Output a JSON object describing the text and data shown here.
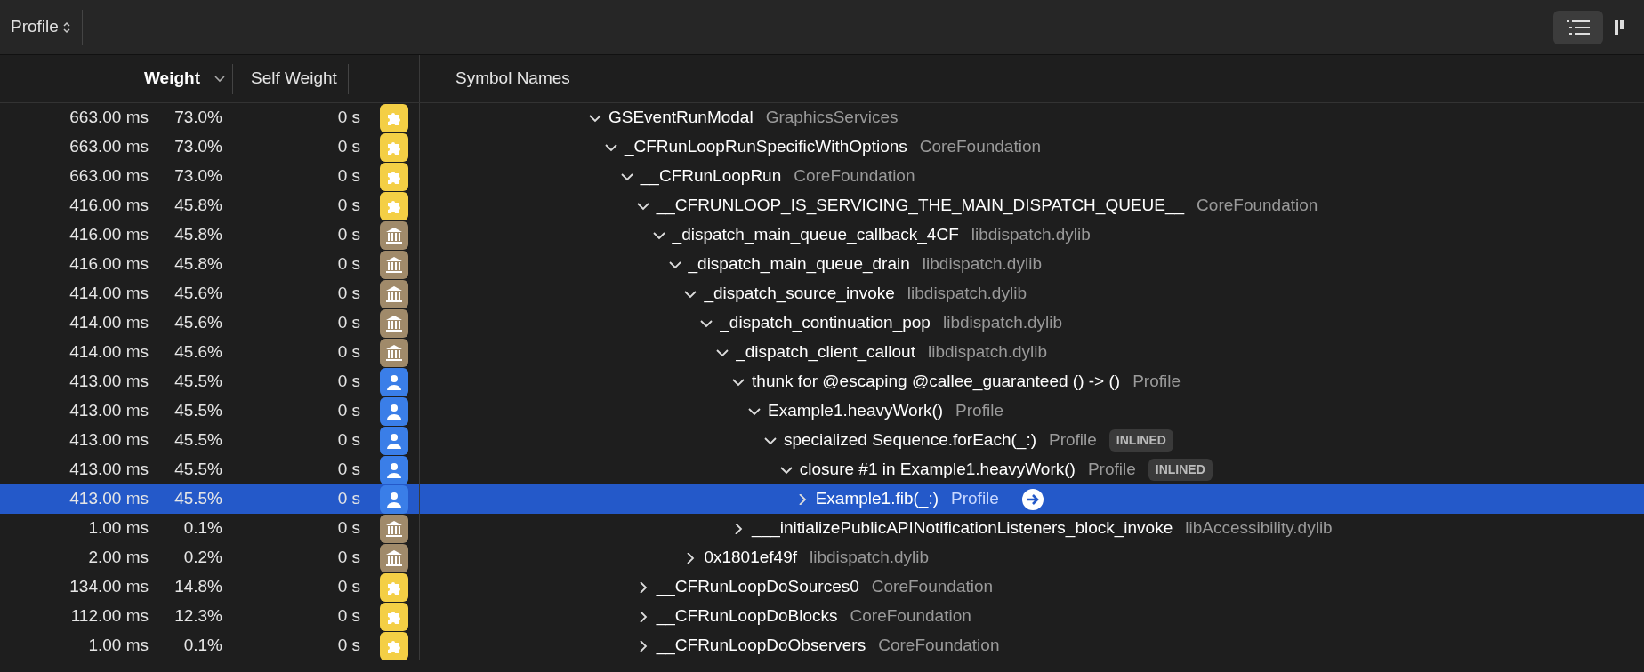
{
  "toolbar": {
    "view_menu": {
      "label": "Profile"
    },
    "view_buttons": [
      {
        "kind": "list",
        "selected": true
      },
      {
        "kind": "columns",
        "selected": false
      }
    ]
  },
  "columns": [
    {
      "label": "Weight",
      "sorted": true
    },
    {
      "label": "Self Weight",
      "sorted": false
    },
    {
      "label": "Symbol Names",
      "sorted": false
    }
  ],
  "call_tree": [
    {
      "name": "GSEventRunModal",
      "library": "GraphicsServices",
      "weight": "663.00 ms",
      "percent": "73.0%",
      "self_weight": "0 s",
      "kind": "plugin",
      "expanded": true,
      "selected": false,
      "children": [
        {
          "name": "_CFRunLoopRunSpecificWithOptions",
          "library": "CoreFoundation",
          "weight": "663.00 ms",
          "percent": "73.0%",
          "self_weight": "0 s",
          "kind": "plugin",
          "expanded": true,
          "selected": false,
          "children": [
            {
              "name": "__CFRunLoopRun",
              "library": "CoreFoundation",
              "weight": "663.00 ms",
              "percent": "73.0%",
              "self_weight": "0 s",
              "kind": "plugin",
              "expanded": true,
              "selected": false,
              "children": [
                {
                  "name": "__CFRUNLOOP_IS_SERVICING_THE_MAIN_DISPATCH_QUEUE__",
                  "library": "CoreFoundation",
                  "weight": "416.00 ms",
                  "percent": "45.8%",
                  "self_weight": "0 s",
                  "kind": "plugin",
                  "expanded": true,
                  "selected": false,
                  "children": [
                    {
                      "name": "_dispatch_main_queue_callback_4CF",
                      "library": "libdispatch.dylib",
                      "weight": "416.00 ms",
                      "percent": "45.8%",
                      "self_weight": "0 s",
                      "kind": "library",
                      "expanded": true,
                      "selected": false,
                      "children": [
                        {
                          "name": "_dispatch_main_queue_drain",
                          "library": "libdispatch.dylib",
                          "weight": "416.00 ms",
                          "percent": "45.8%",
                          "self_weight": "0 s",
                          "kind": "library",
                          "expanded": true,
                          "selected": false,
                          "children": [
                            {
                              "name": "_dispatch_source_invoke",
                              "library": "libdispatch.dylib",
                              "weight": "414.00 ms",
                              "percent": "45.6%",
                              "self_weight": "0 s",
                              "kind": "library",
                              "expanded": true,
                              "selected": false,
                              "children": [
                                {
                                  "name": "_dispatch_continuation_pop",
                                  "library": "libdispatch.dylib",
                                  "weight": "414.00 ms",
                                  "percent": "45.6%",
                                  "self_weight": "0 s",
                                  "kind": "library",
                                  "expanded": true,
                                  "selected": false,
                                  "children": [
                                    {
                                      "name": "_dispatch_client_callout",
                                      "library": "libdispatch.dylib",
                                      "weight": "414.00 ms",
                                      "percent": "45.6%",
                                      "self_weight": "0 s",
                                      "kind": "library",
                                      "expanded": true,
                                      "selected": false,
                                      "children": [
                                        {
                                          "name": "thunk for @escaping @callee_guaranteed () -> ()",
                                          "library": "Profile",
                                          "weight": "413.00 ms",
                                          "percent": "45.5%",
                                          "self_weight": "0 s",
                                          "kind": "user",
                                          "expanded": true,
                                          "selected": false,
                                          "children": [
                                            {
                                              "name": "Example1.heavyWork()",
                                              "library": "Profile",
                                              "weight": "413.00 ms",
                                              "percent": "45.5%",
                                              "self_weight": "0 s",
                                              "kind": "user",
                                              "expanded": true,
                                              "selected": false,
                                              "children": [
                                                {
                                                  "name": "specialized Sequence.forEach(_:)",
                                                  "library": "Profile",
                                                  "badge": "INLINED",
                                                  "weight": "413.00 ms",
                                                  "percent": "45.5%",
                                                  "self_weight": "0 s",
                                                  "kind": "user",
                                                  "expanded": true,
                                                  "selected": false,
                                                  "children": [
                                                    {
                                                      "name": "closure #1 in Example1.heavyWork()",
                                                      "library": "Profile",
                                                      "badge": "INLINED",
                                                      "weight": "413.00 ms",
                                                      "percent": "45.5%",
                                                      "self_weight": "0 s",
                                                      "kind": "user",
                                                      "expanded": true,
                                                      "selected": false,
                                                      "children": [
                                                        {
                                                          "name": "Example1.fib(_:)",
                                                          "library": "Profile",
                                                          "weight": "413.00 ms",
                                                          "percent": "45.5%",
                                                          "self_weight": "0 s",
                                                          "kind": "user",
                                                          "expanded": false,
                                                          "selected": true
                                                        }
                                                      ]
                                                    }
                                                  ]
                                                }
                                              ]
                                            }
                                          ]
                                        },
                                        {
                                          "name": "___initializePublicAPINotificationListeners_block_invoke",
                                          "library": "libAccessibility.dylib",
                                          "weight": "1.00 ms",
                                          "percent": "0.1%",
                                          "self_weight": "0 s",
                                          "kind": "library",
                                          "expanded": false,
                                          "selected": false
                                        }
                                      ]
                                    }
                                  ]
                                }
                              ]
                            },
                            {
                              "name": "0x1801ef49f",
                              "library": "libdispatch.dylib",
                              "weight": "2.00 ms",
                              "percent": "0.2%",
                              "self_weight": "0 s",
                              "kind": "library",
                              "expanded": false,
                              "selected": false
                            }
                          ]
                        }
                      ]
                    }
                  ]
                },
                {
                  "name": "__CFRunLoopDoSources0",
                  "library": "CoreFoundation",
                  "weight": "134.00 ms",
                  "percent": "14.8%",
                  "self_weight": "0 s",
                  "kind": "plugin",
                  "expanded": false,
                  "selected": false
                },
                {
                  "name": "__CFRunLoopDoBlocks",
                  "library": "CoreFoundation",
                  "weight": "112.00 ms",
                  "percent": "12.3%",
                  "self_weight": "0 s",
                  "kind": "plugin",
                  "expanded": false,
                  "selected": false
                },
                {
                  "name": "__CFRunLoopDoObservers",
                  "library": "CoreFoundation",
                  "weight": "1.00 ms",
                  "percent": "0.1%",
                  "self_weight": "0 s",
                  "kind": "plugin",
                  "expanded": false,
                  "selected": false
                }
              ]
            }
          ]
        }
      ]
    }
  ]
}
